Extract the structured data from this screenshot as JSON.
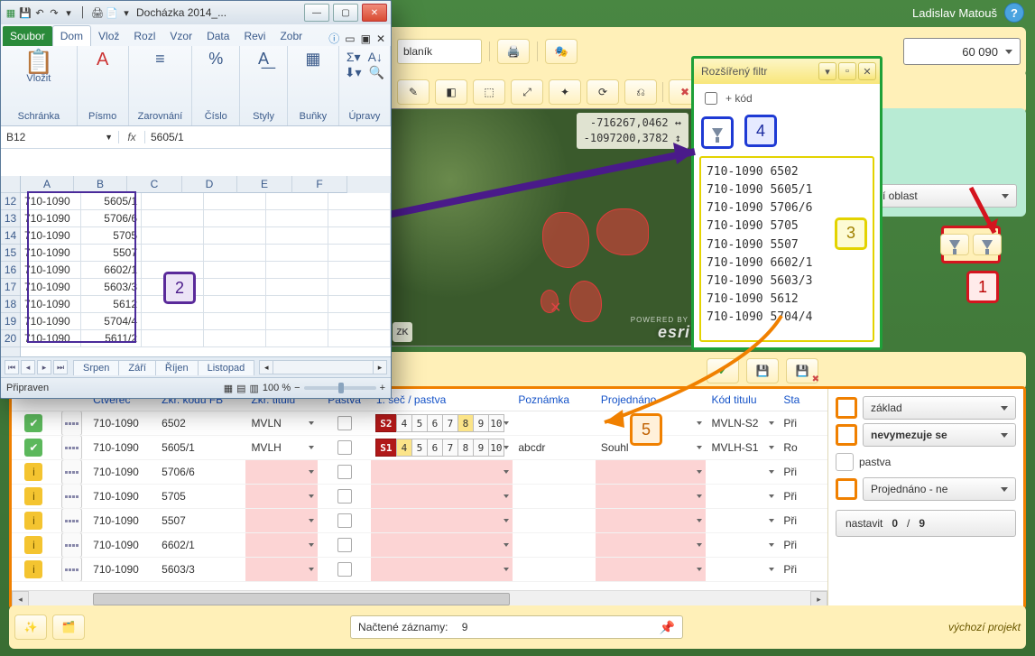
{
  "topbar": {
    "user": "Ladislav  Matouš",
    "help": "?"
  },
  "num_input": "60 090",
  "yr1": {
    "input_text": "blaník"
  },
  "map": {
    "coord1": "-716267,0462 ↔",
    "coord2": "-1097200,3782 ↕",
    "zk": "ZK",
    "powered": "POWERED BY",
    "esri": "esri"
  },
  "teal": {
    "dd1": "tní oblast"
  },
  "ext_filter": {
    "title": "Rozšířený filtr",
    "kod_label": "+ kód",
    "items": [
      "710-1090  6502",
      "710-1090 5605/1",
      "710-1090 5706/6",
      "710-1090 5705",
      "710-1090 5507",
      "710-1090 6602/1",
      "710-1090 5603/3",
      "710-1090 5612",
      "710-1090 5704/4"
    ]
  },
  "grid": {
    "headers": {
      "ctverec": "Čtverec",
      "zkrfb": "Zkr. kódu FB",
      "zkrtit": "Zkr. titulu",
      "pastva": "Pastva",
      "sec": "1. seč / pastva",
      "pozn": "Poznámka",
      "proj": "Projednáno",
      "kodtit": "Kód titulu",
      "sta": "Sta"
    },
    "rows": [
      {
        "ok": "g",
        "ct": "710-1090",
        "fb": "6502",
        "tit": "MVLN",
        "seq": "S2",
        "hl": 8,
        "pozn": "",
        "proj": "",
        "kod": "MVLN-S2",
        "sta": "Při"
      },
      {
        "ok": "g",
        "ct": "710-1090",
        "fb": "5605/1",
        "tit": "MVLH",
        "seq": "S1",
        "hl": 4,
        "pozn": "abcdr",
        "proj": "Souhl",
        "kod": "MVLH-S1",
        "sta": "Ro"
      },
      {
        "ok": "y",
        "ct": "710-1090",
        "fb": "5706/6",
        "tit": "",
        "seq": "",
        "hl": 0,
        "pozn": "",
        "proj": "",
        "kod": "",
        "sta": "Při"
      },
      {
        "ok": "y",
        "ct": "710-1090",
        "fb": "5705",
        "tit": "",
        "seq": "",
        "hl": 0,
        "pozn": "",
        "proj": "",
        "kod": "",
        "sta": "Při"
      },
      {
        "ok": "y",
        "ct": "710-1090",
        "fb": "5507",
        "tit": "",
        "seq": "",
        "hl": 0,
        "pozn": "",
        "proj": "",
        "kod": "",
        "sta": "Při"
      },
      {
        "ok": "y",
        "ct": "710-1090",
        "fb": "6602/1",
        "tit": "",
        "seq": "",
        "hl": 0,
        "pozn": "",
        "proj": "",
        "kod": "",
        "sta": "Při"
      },
      {
        "ok": "y",
        "ct": "710-1090",
        "fb": "5603/3",
        "tit": "",
        "seq": "",
        "hl": 0,
        "pozn": "",
        "proj": "",
        "kod": "",
        "sta": "Při"
      }
    ]
  },
  "side": {
    "dd1": "základ",
    "dd2": "nevymezuje se",
    "cb3": "pastva",
    "dd4": "Projednáno - ne",
    "nav": "nastavit",
    "count": "0",
    "sep": "/",
    "total": "9"
  },
  "status": {
    "label": "Načtené záznamy:",
    "val": "9",
    "proj": "výchozí projekt"
  },
  "excel": {
    "title": "Docházka 2014_...",
    "tabs": {
      "file": "Soubor",
      "home": "Dom",
      "vloz": "Vlož",
      "rozl": "Rozl",
      "vzor": "Vzor",
      "data": "Data",
      "revi": "Revi",
      "zobr": "Zobr"
    },
    "groups": {
      "schranka": "Schránka",
      "vlozit": "Vložit",
      "pismo": "Písmo",
      "zarov": "Zarovnání",
      "cislo": "Číslo",
      "styly": "Styly",
      "bunky": "Buňky",
      "upravy": "Úpravy"
    },
    "namebox": "B12",
    "fx": "fx",
    "formula": "5605/1",
    "col_heads": [
      "A",
      "B",
      "C",
      "D",
      "E",
      "F"
    ],
    "row_heads": [
      "12",
      "13",
      "14",
      "15",
      "16",
      "17",
      "18",
      "19",
      "20"
    ],
    "cells": [
      [
        "710-1090",
        "5605/1",
        "",
        "",
        "",
        ""
      ],
      [
        "710-1090",
        "5706/6",
        "",
        "",
        "",
        ""
      ],
      [
        "710-1090",
        "5705",
        "",
        "",
        "",
        ""
      ],
      [
        "710-1090",
        "5507",
        "",
        "",
        "",
        ""
      ],
      [
        "710-1090",
        "6602/1",
        "",
        "",
        "",
        ""
      ],
      [
        "710-1090",
        "5603/3",
        "",
        "",
        "",
        ""
      ],
      [
        "710-1090",
        "5612",
        "",
        "",
        "",
        ""
      ],
      [
        "710-1090",
        "5704/4",
        "",
        "",
        "",
        ""
      ],
      [
        "710-1090",
        "5611/2",
        "",
        "",
        "",
        ""
      ]
    ],
    "sheets": [
      "Srpen",
      "Září",
      "Říjen",
      "Listopad"
    ],
    "status": "Připraven",
    "zoom": "100 %"
  },
  "callouts": {
    "1": "1",
    "2": "2",
    "3": "3",
    "4": "4",
    "5": "5"
  }
}
